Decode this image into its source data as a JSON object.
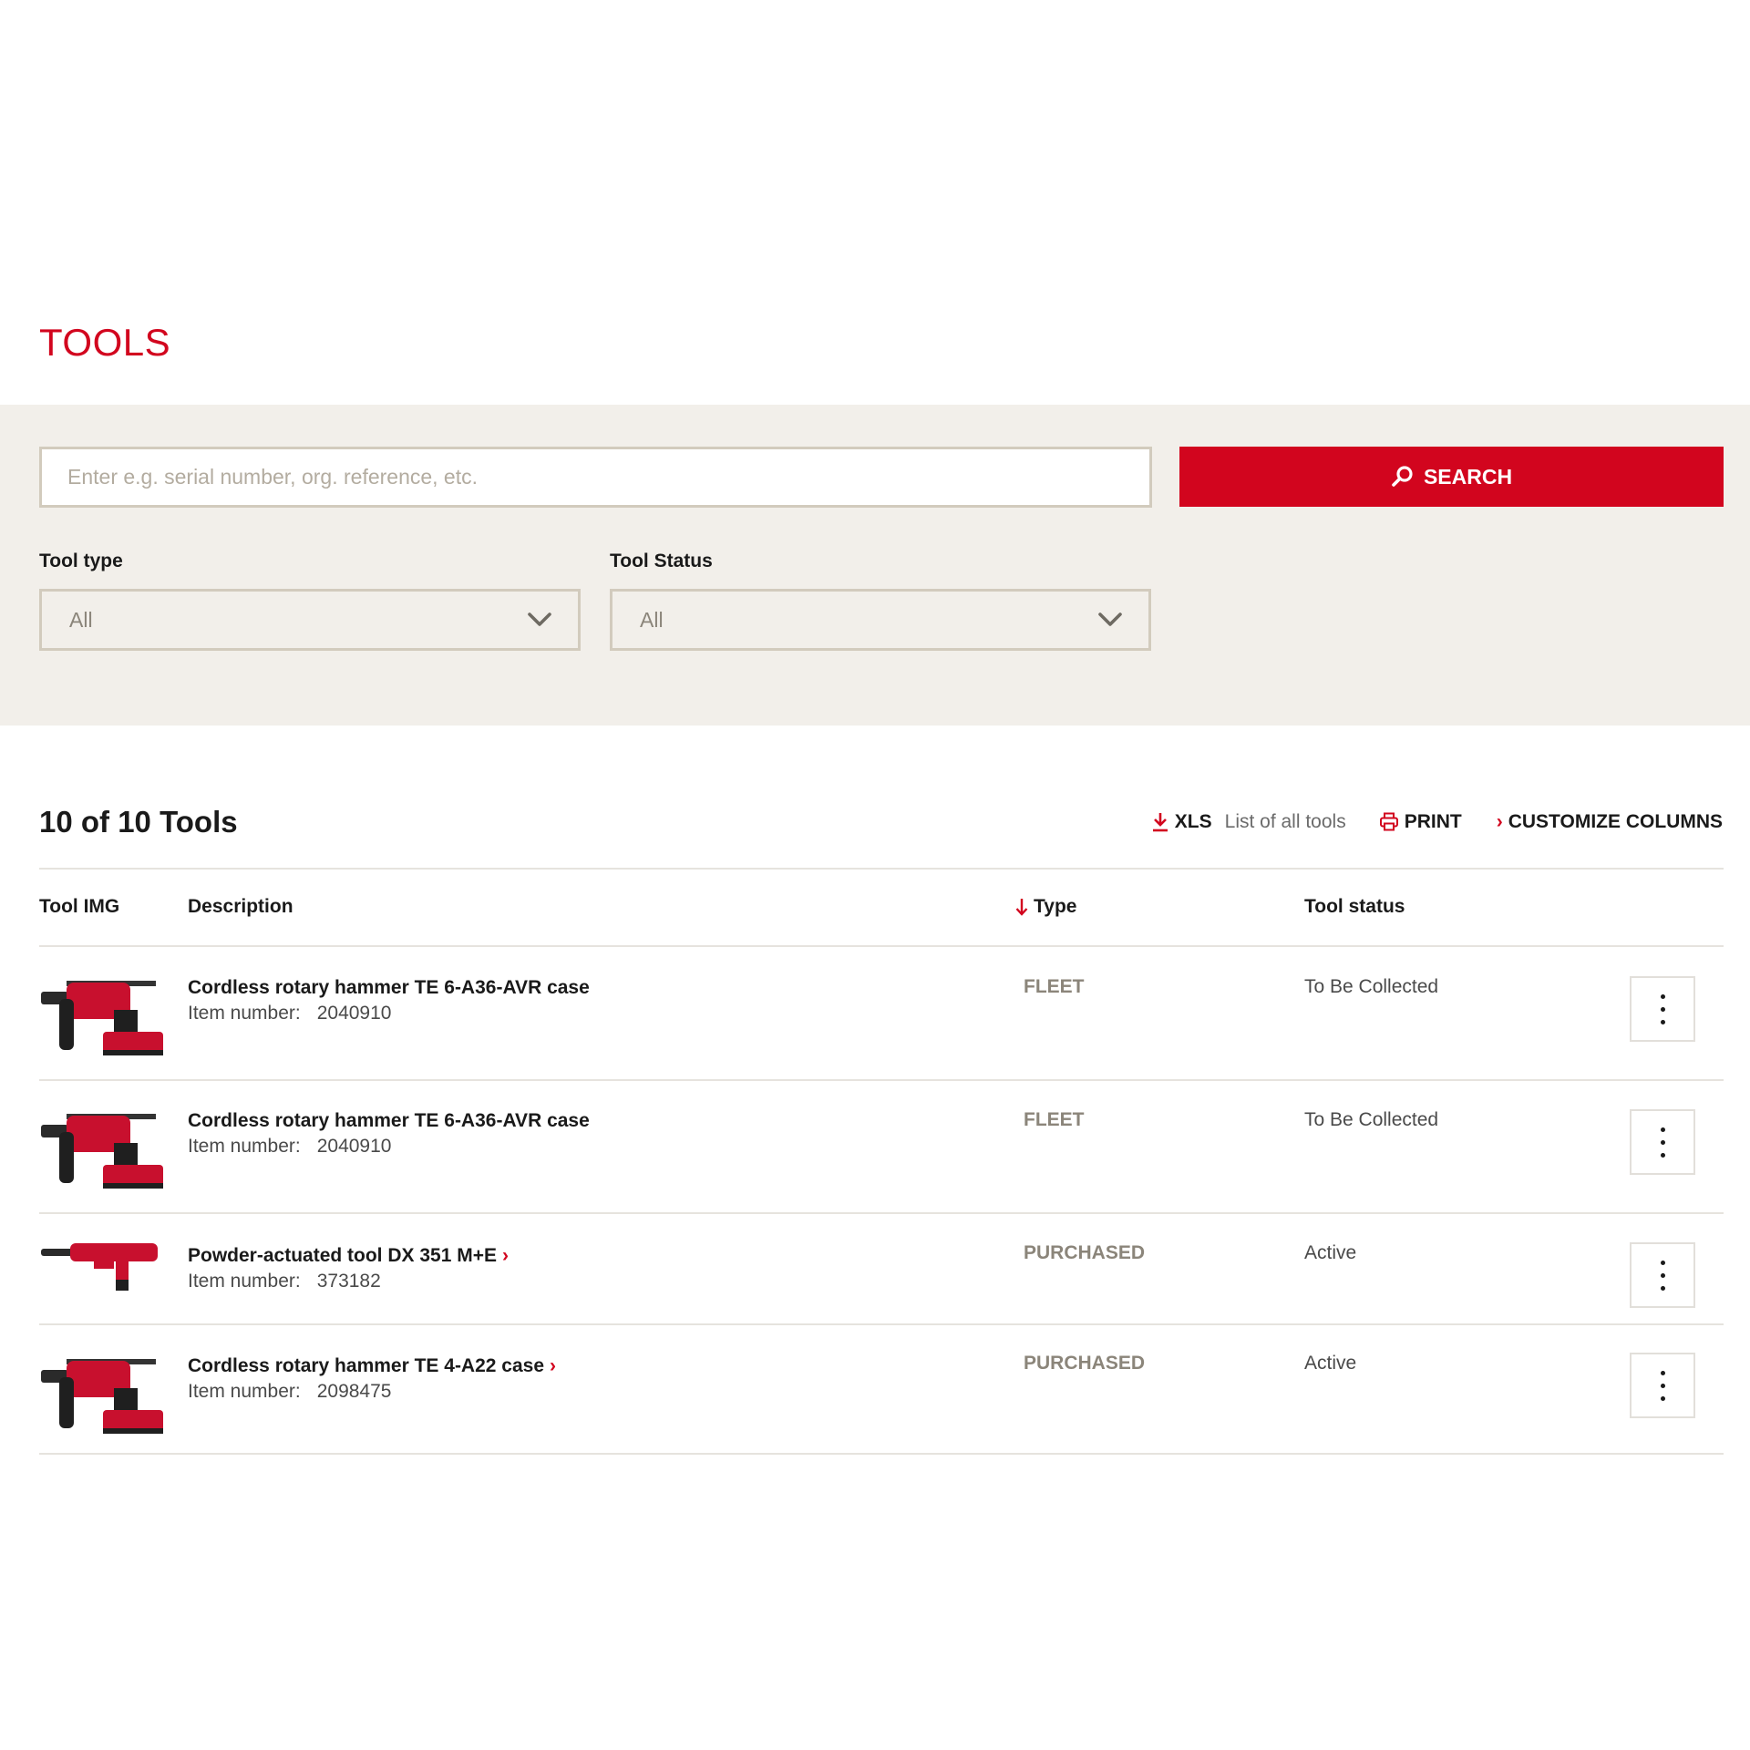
{
  "page": {
    "title": "TOOLS"
  },
  "search": {
    "placeholder": "Enter e.g. serial number, org. reference, etc.",
    "button_label": "SEARCH"
  },
  "filters": {
    "tool_type": {
      "label": "Tool type",
      "value": "All"
    },
    "tool_status": {
      "label": "Tool Status",
      "value": "All"
    }
  },
  "results": {
    "count_text": "10 of 10 Tools",
    "xls_label": "XLS",
    "xls_desc": "List of all tools",
    "print_label": "PRINT",
    "customize_label": "CUSTOMIZE COLUMNS"
  },
  "table": {
    "headers": {
      "tool_img": "Tool IMG",
      "description": "Description",
      "type": "Type",
      "tool_status": "Tool status"
    },
    "item_number_label": "Item number:",
    "rows": [
      {
        "description": "Cordless rotary hammer TE 6-A36-AVR case",
        "item_number": "2040910",
        "type": "FLEET",
        "status": "To Be Collected",
        "has_link": false,
        "image": "rotary-hammer"
      },
      {
        "description": "Cordless rotary hammer TE 6-A36-AVR case",
        "item_number": "2040910",
        "type": "FLEET",
        "status": "To Be Collected",
        "has_link": false,
        "image": "rotary-hammer"
      },
      {
        "description": "Powder-actuated tool DX 351 M+E",
        "item_number": "373182",
        "type": "PURCHASED",
        "status": "Active",
        "has_link": true,
        "image": "powder-actuated-tool"
      },
      {
        "description": "Cordless rotary hammer TE 4-A22 case",
        "item_number": "2098475",
        "type": "PURCHASED",
        "status": "Active",
        "has_link": true,
        "image": "rotary-hammer"
      }
    ]
  },
  "colors": {
    "brand_red": "#d2051e",
    "panel_bg": "#f2efea",
    "field_border": "#d2cbbd"
  },
  "icons": {
    "search": "search-icon",
    "dropdown": "chevron-down-icon",
    "xls": "download-icon",
    "print": "print-icon",
    "sort": "arrow-down-icon",
    "row_menu": "more-vertical-icon"
  }
}
